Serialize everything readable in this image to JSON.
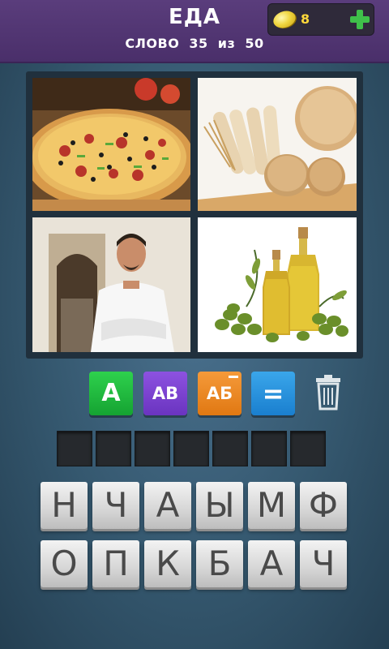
{
  "header": {
    "category": "ЕДА",
    "level_word": "СЛОВО",
    "level_current": "35",
    "level_of": "из",
    "level_total": "50",
    "coins": "8"
  },
  "pictures": [
    {
      "name": "pizza"
    },
    {
      "name": "bread"
    },
    {
      "name": "chef"
    },
    {
      "name": "olive-oil"
    }
  ],
  "hints": {
    "reveal_letter": "A",
    "remove_letters": "AB",
    "remove_letters_cyr": "АБ",
    "solve": "="
  },
  "answer_slots": 7,
  "keyboard": {
    "row1": [
      "Н",
      "Ч",
      "А",
      "Ы",
      "М",
      "Ф"
    ],
    "row2": [
      "О",
      "П",
      "К",
      "Б",
      "А",
      "Ч"
    ]
  },
  "colors": {
    "header": "#4a2f6a",
    "hint_green": "#15a332",
    "hint_purple": "#6a34c0",
    "hint_orange": "#e07812",
    "hint_blue": "#1a7fcf",
    "coin_text": "#ffd83a"
  }
}
